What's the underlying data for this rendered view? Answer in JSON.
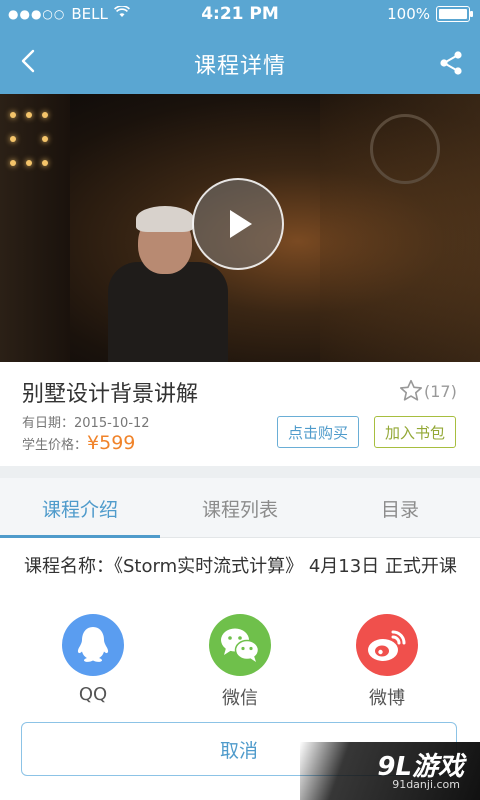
{
  "status_bar": {
    "carrier": "BELL",
    "time": "4:21 PM",
    "battery": "100%",
    "battery_level": 1.0
  },
  "nav": {
    "title": "课程详情",
    "back_icon": "chevron-left-icon",
    "share_icon": "share-icon"
  },
  "course": {
    "name": "别墅设计背景讲解",
    "favorite_count": "(17)",
    "date_label": "有日期：",
    "date": "2015-10-12",
    "price_label": "学生价格：",
    "price": "¥599",
    "buy_label": "点击购买",
    "bag_label": "加入书包"
  },
  "tabs": [
    {
      "label": "课程介绍",
      "active": true
    },
    {
      "label": "课程列表",
      "active": false
    },
    {
      "label": "目录",
      "active": false
    }
  ],
  "description": "课程名称：《Storm实时流式计算》 4月13日 正式开课",
  "share_sheet": {
    "items": [
      {
        "label": "QQ",
        "icon": "qq-icon",
        "color": "#5a9df0"
      },
      {
        "label": "微信",
        "icon": "wechat-icon",
        "color": "#6fc04b"
      },
      {
        "label": "微博",
        "icon": "weibo-icon",
        "color": "#f0504c"
      }
    ],
    "cancel_label": "取消"
  },
  "watermark": {
    "logo": "9L游戏",
    "url": "91danji.com"
  },
  "colors": {
    "primary": "#5aa6d2",
    "accent_blue": "#4f9bcb",
    "price_orange": "#f0832a",
    "olive": "#93a836"
  }
}
